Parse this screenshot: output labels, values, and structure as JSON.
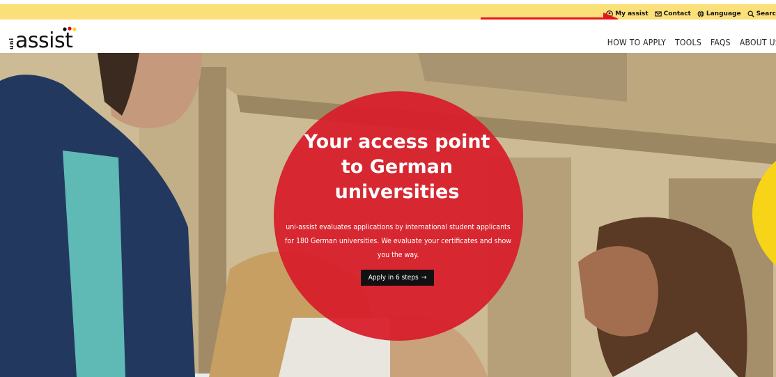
{
  "utility_bar": {
    "items": [
      {
        "label": "My assist",
        "icon": "user-circle-icon"
      },
      {
        "label": "Contact",
        "icon": "mail-icon"
      },
      {
        "label": "Language",
        "icon": "globe-icon"
      },
      {
        "label": "Searc",
        "icon": "search-icon"
      }
    ]
  },
  "logo": {
    "prefix": "uni",
    "word": "assist"
  },
  "nav": {
    "items": [
      "HOW TO APPLY",
      "TOOLS",
      "FAQS",
      "ABOUT US"
    ]
  },
  "hero": {
    "headline": "Your access point to German universities",
    "text": "uni-assist evaluates applications by international student applicants for 180 German universities. We evaluate your certificates and show you the way.",
    "cta_label": "Apply in 6 steps",
    "cta_icon": "arrow-right-icon"
  },
  "colors": {
    "topbar": "#fbe07a",
    "accent_red": "#d81e2a",
    "annotation_arrow": "#e8141b"
  }
}
